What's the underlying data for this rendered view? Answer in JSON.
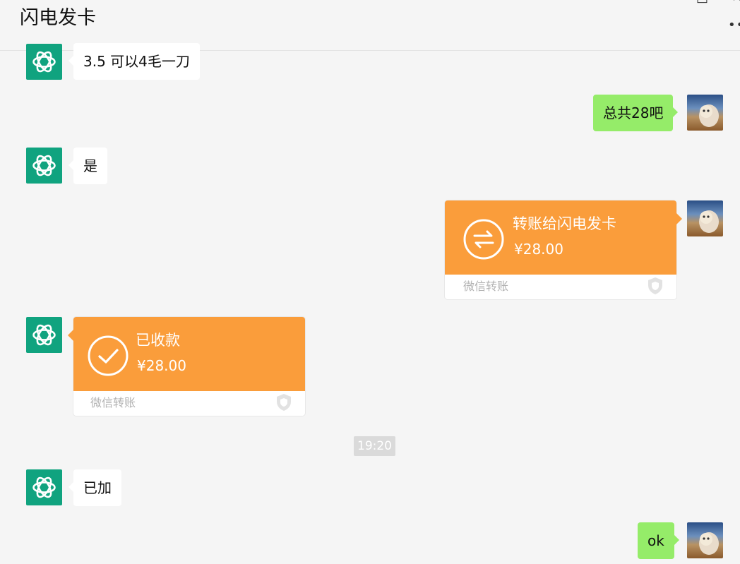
{
  "chat": {
    "title": "闪电发卡",
    "window_controls": [
      "minimize-icon",
      "maximize-icon",
      "close-icon"
    ],
    "more_label": "••"
  },
  "messages": [
    {
      "sender": "bot",
      "type": "text",
      "text": "3.5 可以4毛一刀"
    },
    {
      "sender": "user",
      "type": "text",
      "text": "总共28吧"
    },
    {
      "sender": "bot",
      "type": "text",
      "text": "是"
    },
    {
      "sender": "user",
      "type": "transfer",
      "title": "转账给闪电发卡",
      "amount": "¥28.00",
      "footer": "微信转账",
      "icon": "transfer-arrows-icon"
    },
    {
      "sender": "bot",
      "type": "transfer",
      "title": "已收款",
      "amount": "¥28.00",
      "footer": "微信转账",
      "icon": "checkmark-icon"
    },
    {
      "sender": "system",
      "type": "time",
      "text": "19:20"
    },
    {
      "sender": "bot",
      "type": "text",
      "text": "已加"
    },
    {
      "sender": "user",
      "type": "text",
      "text": "ok"
    }
  ],
  "colors": {
    "background": "#f5f5f5",
    "user_bubble": "#95ec69",
    "bot_bubble": "#ffffff",
    "transfer_card": "#fa9d3b",
    "bot_avatar": "#10a37f"
  }
}
